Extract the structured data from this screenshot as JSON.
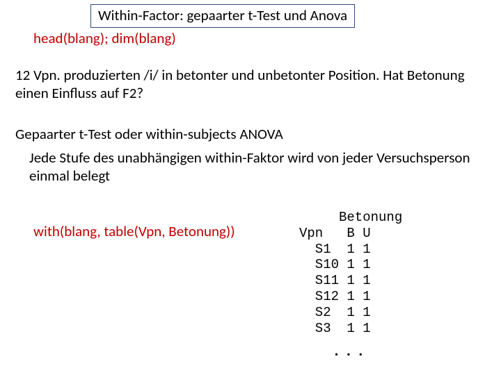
{
  "title": "Within-Factor: gepaarter t-Test und Anova",
  "code_head": "head(blang); dim(blang)",
  "paragraph1": "12 Vpn. produzierten /i/ in betonter und unbetonter Position. Hat Betonung einen Einfluss auf F2?",
  "paragraph2": "Gepaarter t-Test oder within-subjects ANOVA",
  "paragraph3": "Jede Stufe des unabhängigen within-Faktor wird von jeder Versuchsperson einmal belegt",
  "code_with": "with(blang, table(Vpn, Betonung))",
  "chart_data": {
    "type": "table",
    "title": "Betonung",
    "columns": [
      "Vpn",
      "B",
      "U"
    ],
    "rows": [
      {
        "Vpn": "S1",
        "B": 1,
        "U": 1
      },
      {
        "Vpn": "S10",
        "B": 1,
        "U": 1
      },
      {
        "Vpn": "S11",
        "B": 1,
        "U": 1
      },
      {
        "Vpn": "S12",
        "B": 1,
        "U": 1
      },
      {
        "Vpn": "S2",
        "B": 1,
        "U": 1
      },
      {
        "Vpn": "S3",
        "B": 1,
        "U": 1
      }
    ]
  },
  "ellipsis": ". . ."
}
